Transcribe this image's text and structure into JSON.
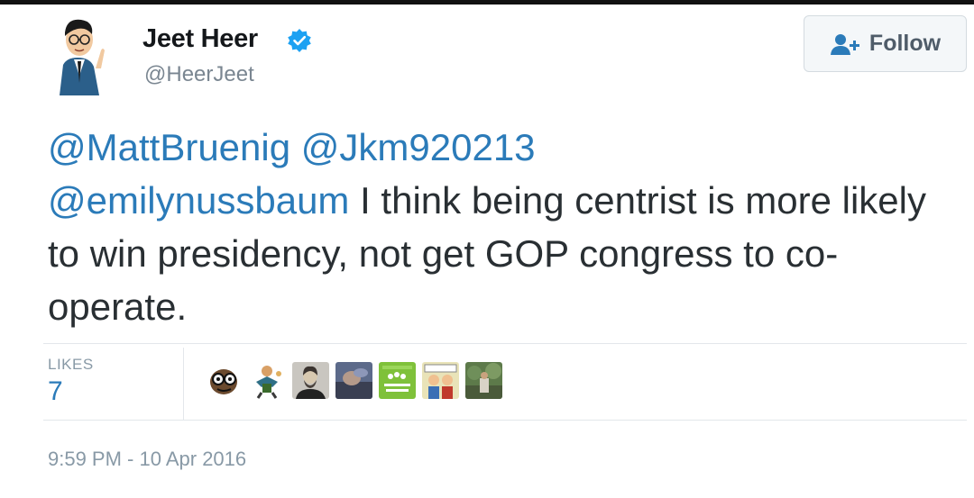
{
  "tweet": {
    "author": {
      "display_name": "Jeet Heer",
      "handle": "@HeerJeet",
      "verified": true,
      "avatar_icon": "cartoon-man-avatar"
    },
    "follow_button": {
      "label": "Follow",
      "icon": "add-user-icon"
    },
    "text": {
      "mention_1": "@MattBruenig",
      "mention_2": "@Jkm920213",
      "mention_3": "@emilynussbaum",
      "body": " I think being centrist is more likely to win presidency, not get GOP congress to co-operate."
    },
    "likes": {
      "label": "LIKES",
      "count": "7"
    },
    "likers": [
      {
        "icon": "cartoon-glasses-avatar"
      },
      {
        "icon": "cartoon-figure-avatar"
      },
      {
        "icon": "bearded-man-photo-avatar"
      },
      {
        "icon": "blurred-photo-avatar"
      },
      {
        "icon": "green-logo-avatar"
      },
      {
        "icon": "comic-panel-avatar"
      },
      {
        "icon": "outdoor-photo-avatar"
      }
    ],
    "timestamp": "9:59 PM - 10 Apr 2016"
  },
  "colors": {
    "link": "#2b7bb9",
    "text": "#292f33",
    "muted": "#8899a6",
    "verified": "#1da1f2"
  }
}
